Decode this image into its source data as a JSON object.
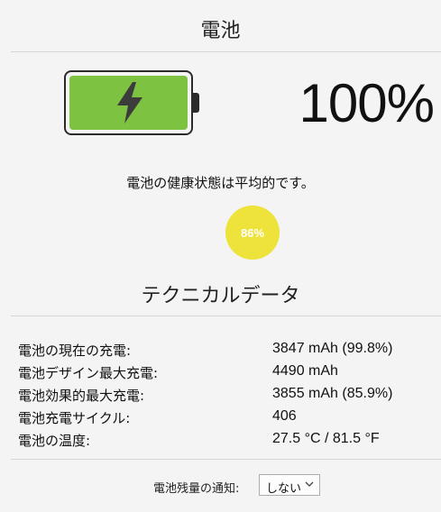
{
  "header": {
    "title": "電池"
  },
  "battery": {
    "level_percent": 100,
    "level_text": "100%",
    "fill_color": "#7ec242",
    "icon": "bolt-icon"
  },
  "health": {
    "message": "電池の健康状態は平均的です。",
    "badge_text": "86%",
    "badge_color": "#ede33a"
  },
  "technical": {
    "title": "テクニカルデータ",
    "rows": [
      {
        "label": "電池の現在の充電:",
        "value": "3847 mAh (99.8%)"
      },
      {
        "label": "電池デザイン最大充電:",
        "value": "4490 mAh"
      },
      {
        "label": "電池効果的最大充電:",
        "value": "3855 mAh (85.9%)"
      },
      {
        "label": "電池充電サイクル:",
        "value": "406"
      },
      {
        "label": "電池の温度:",
        "value": "27.5 °C / 81.5 °F"
      }
    ]
  },
  "notification": {
    "label": "電池残量の通知:",
    "selected": "しない"
  }
}
